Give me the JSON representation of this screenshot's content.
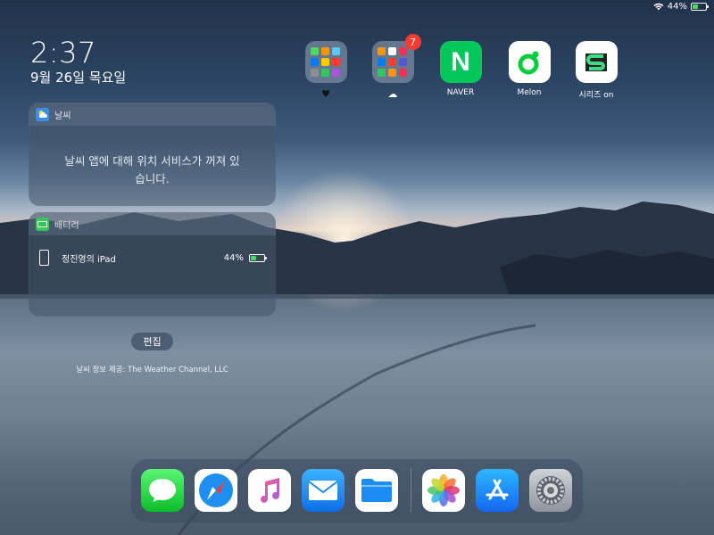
{
  "status_bar": {
    "battery_text": "44%",
    "battery_level": 0.44
  },
  "lock": {
    "time": "2:37",
    "date": "9월 26일 목요일"
  },
  "widgets": {
    "weather": {
      "title": "날씨",
      "message_line1": "날씨 앱에 대해 위치 서비스가 꺼져 있",
      "message_line2": "습니다."
    },
    "battery": {
      "title": "배터리",
      "device_name": "정진영의 iPad",
      "percent": "44%",
      "level": 0.44
    }
  },
  "edit_button": "편집",
  "weather_credit": "날씨 정보 제공: The Weather Channel, LLC",
  "top_apps": [
    {
      "label": "",
      "type": "folder"
    },
    {
      "label": "",
      "type": "folder",
      "badge": "7"
    },
    {
      "label": "NAVER"
    },
    {
      "label": "Melon"
    },
    {
      "label": "시리즈 on"
    }
  ],
  "dock_apps": [
    "messages-icon",
    "safari-icon",
    "music-icon",
    "mail-icon",
    "files-icon",
    "photos-icon",
    "app-store-icon",
    "settings-icon"
  ],
  "colors": {
    "naver": "#03c75a",
    "melon": "#00cd3c",
    "series_on": "#3ddc84",
    "battery_green": "#4cd964",
    "badge_red": "#ff3b30"
  }
}
